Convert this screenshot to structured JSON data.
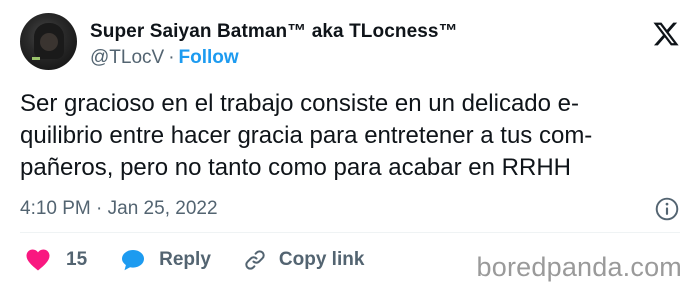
{
  "author": {
    "display_name": "Super Saiyan Batman™ aka TLocness™",
    "handle": "@TLocV",
    "separator": "·",
    "follow_label": "Follow"
  },
  "tweet": {
    "lines": [
      "Ser gracioso en el trabajo consiste en un delicado e-",
      "quilibrio entre hacer gracia para entretener a tus com-",
      "pañeros, pero no tanto como para acabar en RRHH"
    ],
    "timestamp": "4:10 PM · Jan 25, 2022"
  },
  "actions": {
    "like_count": "15",
    "reply_label": "Reply",
    "copy_link_label": "Copy link"
  },
  "icons": {
    "platform": "x-logo-icon",
    "info": "info-icon",
    "like": "heart-icon",
    "reply": "speech-bubble-icon",
    "copy": "link-icon"
  },
  "colors": {
    "text": "#0f1419",
    "secondary": "#536471",
    "accent_blue": "#1d9bf0",
    "like_pink": "#f91880",
    "watermark": "#9a9a9a"
  },
  "watermark": "boredpanda.com"
}
